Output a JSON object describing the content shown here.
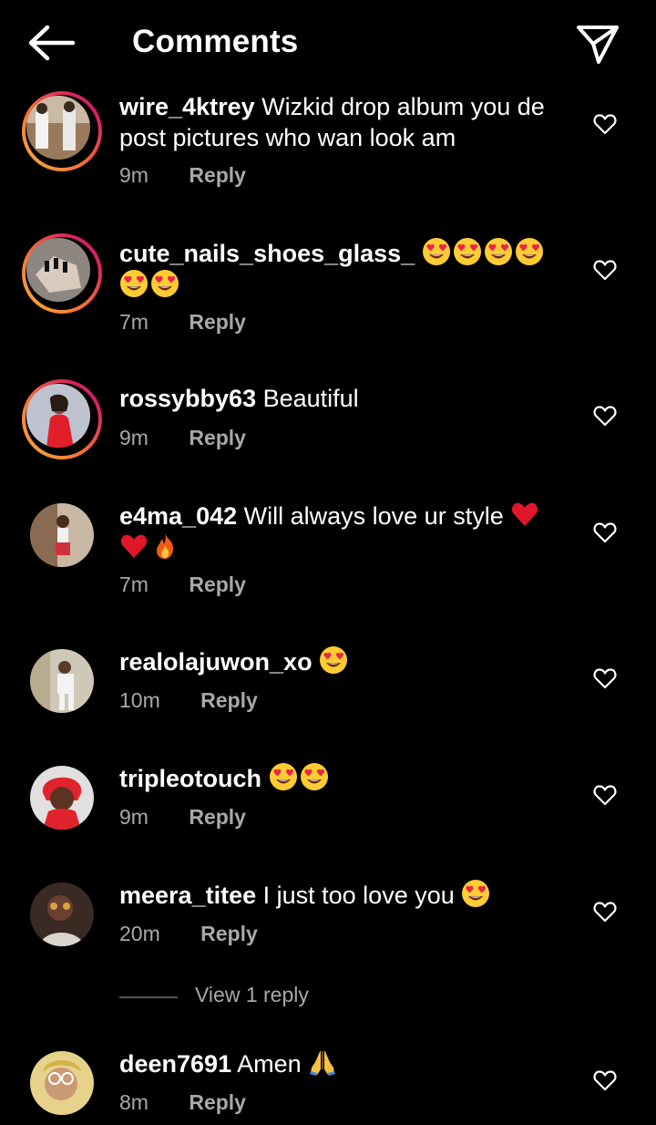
{
  "header": {
    "title": "Comments"
  },
  "comments": [
    {
      "username": "wire_4ktrey",
      "text": "Wizkid drop album you de post pictures who wan look am",
      "time": "9m",
      "reply": "Reply"
    },
    {
      "username": "cute_nails_shoes_glass_",
      "text": "",
      "time": "7m",
      "reply": "Reply"
    },
    {
      "username": "rossybby63",
      "text": "Beautiful",
      "time": "9m",
      "reply": "Reply"
    },
    {
      "username": "e4ma_042",
      "text": "Will always love ur style",
      "time": "7m",
      "reply": "Reply"
    },
    {
      "username": "realolajuwon_xo",
      "text": "",
      "time": "10m",
      "reply": "Reply"
    },
    {
      "username": "tripleotouch",
      "text": "",
      "time": "9m",
      "reply": "Reply"
    },
    {
      "username": "meera_titee",
      "text": "I just too love you",
      "time": "20m",
      "reply": "Reply"
    },
    {
      "username": "deen7691",
      "text": "Amen",
      "time": "8m",
      "reply": "Reply"
    }
  ],
  "view_replies": {
    "label": "View 1 reply"
  }
}
